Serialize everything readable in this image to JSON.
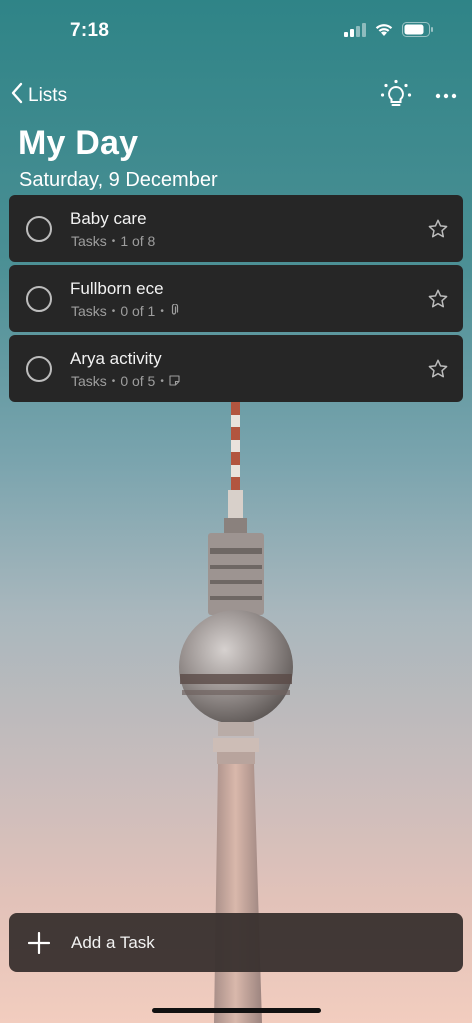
{
  "status_bar": {
    "time": "7:18"
  },
  "nav": {
    "back_label": "Lists"
  },
  "header": {
    "title": "My Day",
    "date": "Saturday, 9 December"
  },
  "tasks": [
    {
      "name": "Baby care",
      "list": "Tasks",
      "progress": "1 of 8",
      "extra_icon": ""
    },
    {
      "name": "Fullborn ece",
      "list": "Tasks",
      "progress": "0 of 1",
      "extra_icon": "attachment-icon"
    },
    {
      "name": "Arya activity",
      "list": "Tasks",
      "progress": "0 of 5",
      "extra_icon": "note-icon"
    }
  ],
  "add_task": {
    "label": "Add a Task"
  },
  "colors": {
    "card": "#262626",
    "muted_text": "#9e9e9e",
    "add_bar": "#3a3230"
  }
}
